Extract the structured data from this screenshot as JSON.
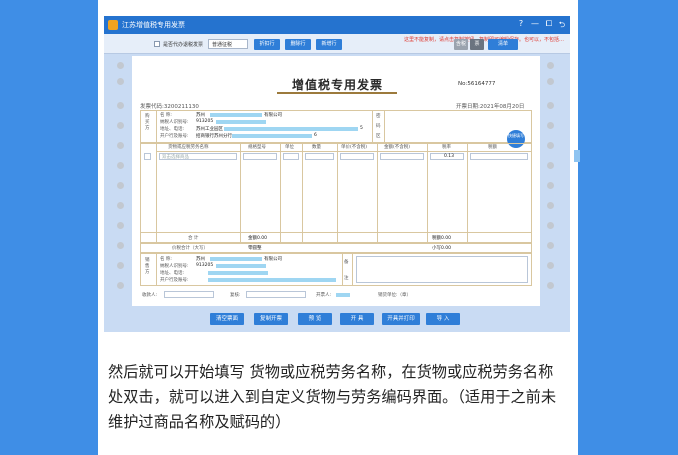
{
  "app": {
    "window_title": "江苏增值税专用发票",
    "window_buttons": [
      "?",
      "—",
      "⧠",
      "⮌"
    ]
  },
  "toolbar": {
    "notice": "这里不能复制，请点击复制按钮，复制即可编辑保存。也可以，不包括…",
    "checkbox_label": "是否代办退税发票",
    "select_value": "普通征税",
    "buttons": [
      "折扣行",
      "删除行",
      "新增行"
    ],
    "right_buttons": [
      "含税",
      "票",
      "清单"
    ]
  },
  "invoice": {
    "title": "增值税专用发票",
    "number": "No:56164777",
    "code": "发票代码:3200211130",
    "date": "开票日期:2021年08月20日",
    "buyer": {
      "section": "购买方",
      "name_label": "名    称:",
      "name_value": "苏州",
      "name_suffix": "有限公司",
      "tax_label": "纳税人识别号:",
      "tax_value": "913205",
      "addr_label": "地址、电话:",
      "addr_value": "苏州工业园区",
      "addr_tail": "5",
      "bank_label": "开户行及账号:",
      "bank_value": "招商银行苏州分行",
      "bank_tail": "6"
    },
    "password_area": [
      "密",
      "码",
      "区"
    ],
    "qr_label": "快捷填写",
    "columns": [
      "货物或应税劳务名称",
      "规格型号",
      "单位",
      "数量",
      "单价(不含税)",
      "金额(不含税)",
      "税率",
      "税额"
    ],
    "row_placeholder": "双击选择商品",
    "tax_rate": "0.13",
    "totals": {
      "label": "合    计",
      "amount": "金额0.00",
      "tax": "税额0.00"
    },
    "total_words": {
      "label": "价税合计（大写）",
      "value": "零圆整",
      "small": "小写0.00"
    },
    "seller": {
      "section": "销售方",
      "name_label": "名    称:",
      "name_value": "苏州",
      "name_suffix": "有限公司",
      "tax_label": "纳税人识别号:",
      "tax_value": "913205",
      "addr_label": "地址、电话:",
      "bank_label": "开户行及账号:",
      "remark": "备",
      "remark2": "注"
    },
    "footer": {
      "payee": "收款人:",
      "reviewer": "复核:",
      "drawer": "开票人:",
      "seller_unit": "销货单位:（章）"
    }
  },
  "bottom_buttons": [
    "清空票面",
    "复制开票",
    "预 览",
    "开 具",
    "开具并打印",
    "导 入"
  ],
  "caption": "然后就可以开始填写 货物或应税劳务名称，在货物或应税劳务名称处双击，就可以进入到自定义货物与劳务编码界面。（适用于之前未维护过商品名称及赋码的）",
  "colors": {
    "page_background": "#3f8ee6",
    "accent_blue": "#2f7ed8",
    "notice_red": "#e0342a",
    "title_bar": "#2573cf"
  }
}
